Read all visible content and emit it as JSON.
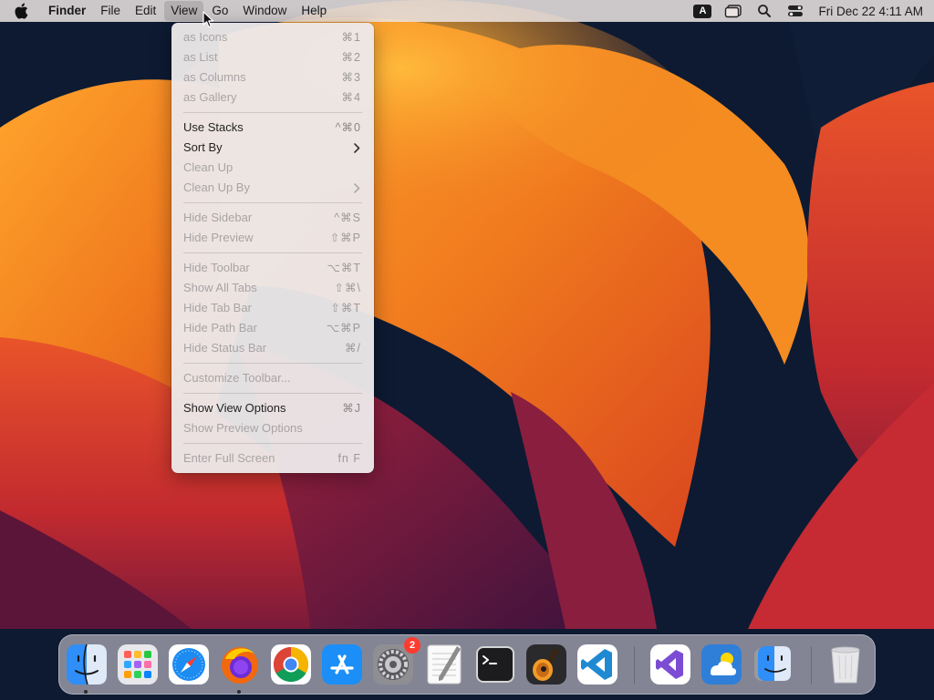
{
  "menubar": {
    "app_name": "Finder",
    "menus": [
      "File",
      "Edit",
      "View",
      "Go",
      "Window",
      "Help"
    ],
    "active_menu": "View",
    "input_source": "A",
    "clock": "Fri Dec 22  4:11 AM"
  },
  "view_menu": {
    "items": [
      {
        "label": "as Icons",
        "shortcut": "⌘1"
      },
      {
        "label": "as List",
        "shortcut": "⌘2"
      },
      {
        "label": "as Columns",
        "shortcut": "⌘3"
      },
      {
        "label": "as Gallery",
        "shortcut": "⌘4"
      },
      {
        "label": "Use Stacks",
        "shortcut": "^⌘0"
      },
      {
        "label": "Sort By"
      },
      {
        "label": "Clean Up"
      },
      {
        "label": "Clean Up By"
      },
      {
        "label": "Hide Sidebar",
        "shortcut": "^⌘S"
      },
      {
        "label": "Hide Preview",
        "shortcut": "⇧⌘P"
      },
      {
        "label": "Hide Toolbar",
        "shortcut": "⌥⌘T"
      },
      {
        "label": "Show All Tabs",
        "shortcut": "⇧⌘\\"
      },
      {
        "label": "Hide Tab Bar",
        "shortcut": "⇧⌘T"
      },
      {
        "label": "Hide Path Bar",
        "shortcut": "⌥⌘P"
      },
      {
        "label": "Hide Status Bar",
        "shortcut": "⌘/"
      },
      {
        "label": "Customize Toolbar..."
      },
      {
        "label": "Show View Options",
        "shortcut": "⌘J"
      },
      {
        "label": "Show Preview Options"
      },
      {
        "label": "Enter Full Screen",
        "shortcut": "fn F"
      }
    ]
  },
  "dock": {
    "system_settings_badge": "2"
  },
  "colors": {
    "menubar_bg": "#ece4e2",
    "menu_bg": "#ece8e9",
    "disabled_text": "#a8a4a5",
    "badge_red": "#ff3b30",
    "wallpaper_orange": "#f3922a",
    "wallpaper_red": "#d8332a",
    "wallpaper_navy": "#0d1a32"
  }
}
